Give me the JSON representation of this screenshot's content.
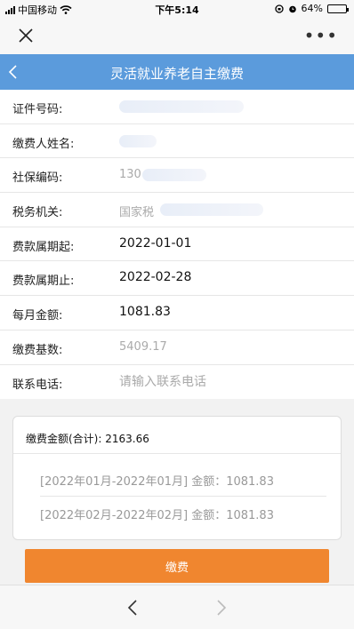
{
  "status_bar": {
    "carrier": "中国移动",
    "time": "下午5:14",
    "battery": "64%",
    "battery_level": 0.64,
    "accent": "#f5c518"
  },
  "header": {
    "title": "灵活就业养老自主缴费",
    "color": "#5b9bdc"
  },
  "form": {
    "id_number_label": "证件号码:",
    "payer_name_label": "缴费人姓名:",
    "social_security_label": "社保编码:",
    "social_security_value": "130",
    "tax_office_label": "税务机关:",
    "tax_office_value": "国家税",
    "period_start_label": "费款属期起:",
    "period_start_value": "2022-01-01",
    "period_end_label": "费款属期止:",
    "period_end_value": "2022-02-28",
    "monthly_amount_label": "每月金额:",
    "monthly_amount_value": "1081.83",
    "base_label": "缴费基数:",
    "base_value": "5409.17",
    "phone_label": "联系电话:",
    "phone_placeholder": "请输入联系电话"
  },
  "summary": {
    "total_label": "缴费金额(合计):",
    "total_value": "2163.66",
    "periods": [
      {
        "text": "[2022年01月-2022年01月] 金额：1081.83"
      },
      {
        "text": "[2022年02月-2022年02月] 金额：1081.83"
      }
    ]
  },
  "pay_button": {
    "label": "缴费",
    "color": "#f0862f"
  }
}
